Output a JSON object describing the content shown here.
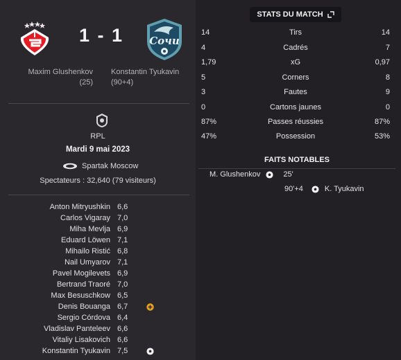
{
  "match": {
    "score": "1 - 1",
    "home_scorer": "Maxim Glushenkov",
    "home_minute": "(25)",
    "away_scorer": "Konstantin Tyukavin",
    "away_minute": "(90+4)",
    "away_crest_text": "Сочи",
    "competition": "RPL",
    "date": "Mardi 9 mai 2023",
    "stadium": "Spartak Moscow",
    "attendance": "Spectateurs : 32,640 (79 visiteurs)"
  },
  "icons": {
    "home_crest": "spartak-crest-icon",
    "away_crest": "sochi-crest-icon",
    "competition": "rpl-logo-icon",
    "stadium": "stadium-icon",
    "expand": "expand-icon",
    "goal": "football-icon",
    "sub": "substitution-icon"
  },
  "colors": {
    "home_red": "#e21d25",
    "away_navy": "#1f4a63",
    "away_teal": "#5f9fb0",
    "sub_yellow": "#e8a41d"
  },
  "ratings": [
    {
      "name": "Anton Mitryushkin",
      "rating": "6,6",
      "event": ""
    },
    {
      "name": "Carlos Vigaray",
      "rating": "7,0",
      "event": ""
    },
    {
      "name": "Miha Mevlja",
      "rating": "6,9",
      "event": ""
    },
    {
      "name": "Eduard Löwen",
      "rating": "7,1",
      "event": ""
    },
    {
      "name": "Mihailo Ristić",
      "rating": "6,8",
      "event": ""
    },
    {
      "name": "Nail Umyarov",
      "rating": "7,1",
      "event": ""
    },
    {
      "name": "Pavel Mogilevets",
      "rating": "6,9",
      "event": ""
    },
    {
      "name": "Bertrand Traoré",
      "rating": "7,0",
      "event": ""
    },
    {
      "name": "Max Besuschkow",
      "rating": "6,5",
      "event": ""
    },
    {
      "name": "Denis Bouanga",
      "rating": "6,7",
      "event": "sub"
    },
    {
      "name": "Sergio Córdova",
      "rating": "6,4",
      "event": ""
    },
    {
      "name": "Vladislav Panteleev",
      "rating": "6,6",
      "event": ""
    },
    {
      "name": "Vitaliy Lisakovich",
      "rating": "6,6",
      "event": ""
    },
    {
      "name": "Konstantin Tyukavin",
      "rating": "7,5",
      "event": "goal"
    }
  ],
  "stats": {
    "title": "STATS DU MATCH",
    "rows": [
      {
        "home": "14",
        "label": "Tirs",
        "away": "14"
      },
      {
        "home": "4",
        "label": "Cadrés",
        "away": "7"
      },
      {
        "home": "1,79",
        "label": "xG",
        "away": "0,97"
      },
      {
        "home": "5",
        "label": "Corners",
        "away": "8"
      },
      {
        "home": "3",
        "label": "Fautes",
        "away": "9"
      },
      {
        "home": "0",
        "label": "Cartons jaunes",
        "away": "0"
      },
      {
        "home": "87%",
        "label": "Passes réussies",
        "away": "87%"
      },
      {
        "home": "47%",
        "label": "Possession",
        "away": "53%"
      }
    ]
  },
  "notable": {
    "title": "FAITS NOTABLES",
    "events": [
      {
        "side": "home",
        "player": "M. Glushenkov",
        "minute": "25'"
      },
      {
        "side": "away",
        "player": "K. Tyukavin",
        "minute": "90'+4"
      }
    ]
  }
}
